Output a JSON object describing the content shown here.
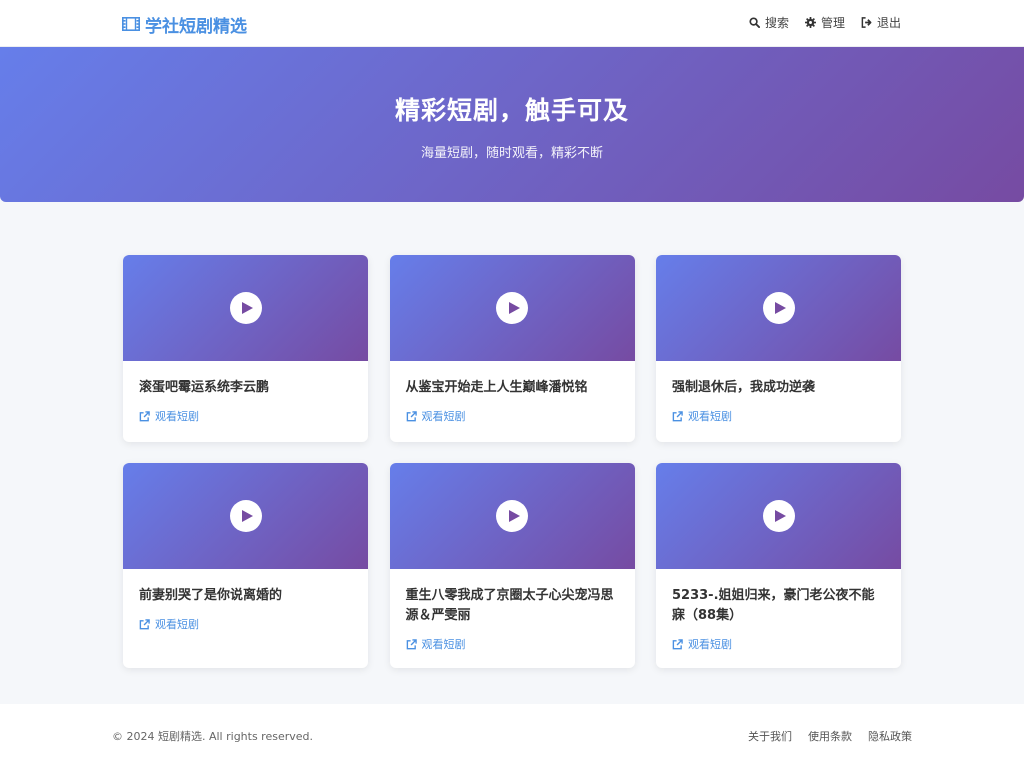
{
  "navbar": {
    "brand": "学社短剧精选",
    "brand_icon": "film-icon",
    "links": [
      {
        "label": "搜索",
        "icon": "search-icon"
      },
      {
        "label": "管理",
        "icon": "gear-icon"
      },
      {
        "label": "退出",
        "icon": "sign-out-icon"
      }
    ]
  },
  "hero": {
    "title": "精彩短剧，触手可及",
    "subtitle": "海量短剧，随时观看，精彩不断"
  },
  "cards": [
    {
      "title": "滚蛋吧霉运系统李云鹏",
      "link": "观看短剧"
    },
    {
      "title": "从鉴宝开始走上人生巅峰潘悦铭",
      "link": "观看短剧"
    },
    {
      "title": "强制退休后，我成功逆袭",
      "link": "观看短剧"
    },
    {
      "title": "前妻别哭了是你说离婚的",
      "link": "观看短剧"
    },
    {
      "title": "重生八零我成了京圈太子心尖宠冯思源＆严雯丽",
      "link": "观看短剧"
    },
    {
      "title": "5233-.姐姐归来，豪门老公夜不能寐（88集）",
      "link": "观看短剧"
    }
  ],
  "footer": {
    "copyright": "© 2024 短剧精选. All rights reserved.",
    "links": [
      "关于我们",
      "使用条款",
      "隐私政策"
    ]
  },
  "colors": {
    "brand": "#4a90e2",
    "gradient_start": "#667eea",
    "gradient_end": "#764ba2"
  }
}
